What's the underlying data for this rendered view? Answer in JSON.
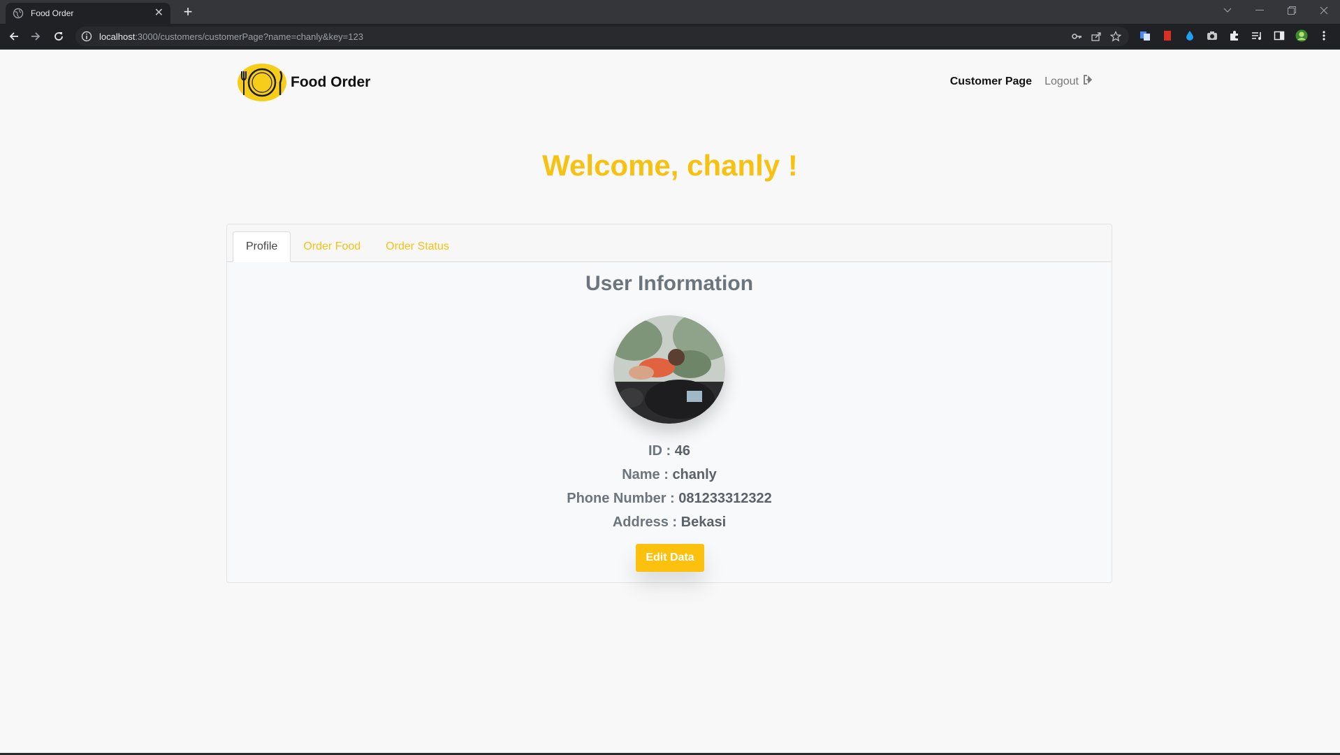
{
  "browser": {
    "tab_title": "Food Order",
    "url_host": "localhost",
    "url_path": ":3000/customers/customerPage?name=chanly&key=123",
    "new_tab": "+",
    "close": "✕"
  },
  "navbar": {
    "brand": "Food Order",
    "customer_page": "Customer Page",
    "logout": "Logout"
  },
  "welcome": "Welcome, chanly !",
  "tabs": [
    "Profile",
    "Order Food",
    "Order Status"
  ],
  "profile": {
    "title": "User Information",
    "id_label": "ID : ",
    "id_value": "46",
    "name_label": "Name : ",
    "name_value": "chanly",
    "phone_label": "Phone Number : ",
    "phone_value": "081233312322",
    "address_label": "Address : ",
    "address_value": "Bekasi",
    "edit_button": "Edit Data"
  },
  "colors": {
    "accent": "#f6c111",
    "button": "#fcc10f",
    "text_muted": "#6c757d"
  }
}
